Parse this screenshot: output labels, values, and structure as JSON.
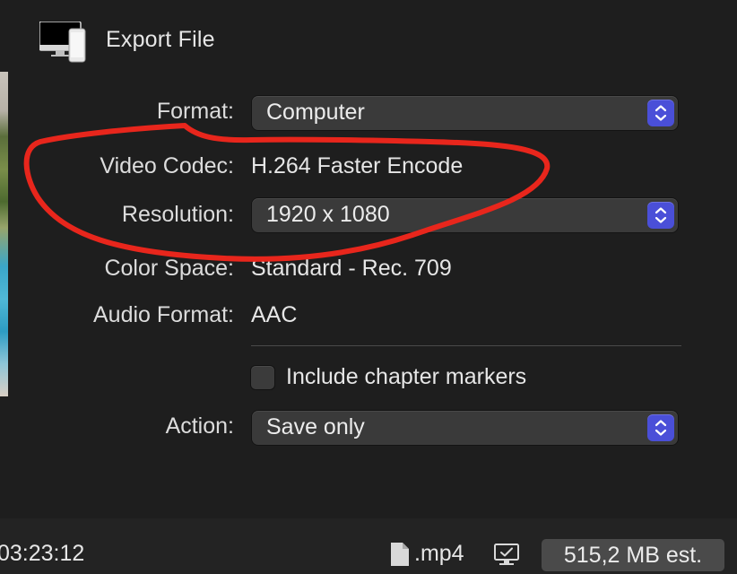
{
  "header": {
    "title": "Export File",
    "icon": "computer-and-phone-icon"
  },
  "form": {
    "format": {
      "label": "Format:",
      "value": "Computer"
    },
    "video_codec": {
      "label": "Video Codec:",
      "value": "H.264 Faster Encode"
    },
    "resolution": {
      "label": "Resolution:",
      "value": "1920 x 1080"
    },
    "color_space": {
      "label": "Color Space:",
      "value": "Standard - Rec. 709"
    },
    "audio_format": {
      "label": "Audio Format:",
      "value": "AAC"
    },
    "chapter_markers": {
      "label": "Include chapter markers",
      "checked": false
    },
    "action": {
      "label": "Action:",
      "value": "Save only"
    }
  },
  "footer": {
    "timecode": "03:23:12",
    "file_extension": ".mp4",
    "file_icon": "document-icon",
    "monitor_icon": "monitor-check-icon",
    "size_estimate": "515,2 MB est."
  },
  "colors": {
    "background": "#1e1e1e",
    "stepper_accent": "#4a4fd8",
    "annotation_red": "#e8261c"
  }
}
